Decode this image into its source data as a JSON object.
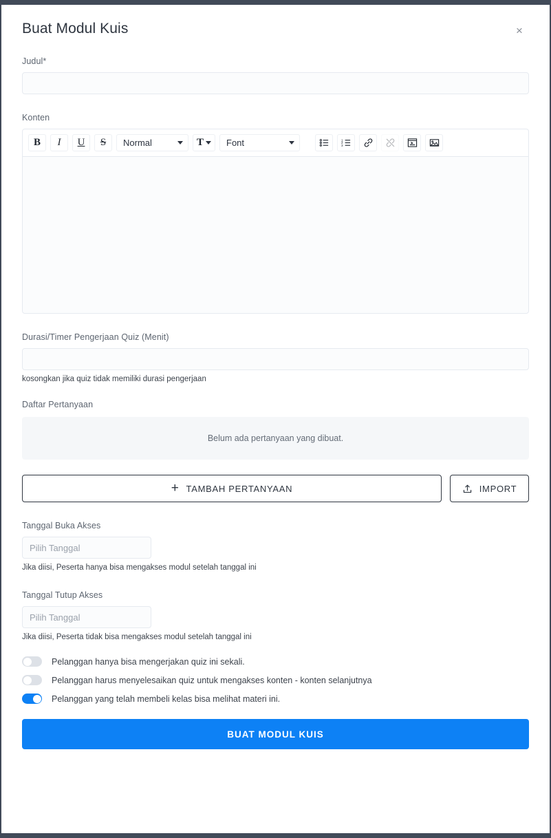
{
  "window": {
    "chrome_color": "#414a58",
    "accent_color": "#0d81f5"
  },
  "header": {
    "title": "Buat Modul Kuis",
    "close_label": "×"
  },
  "fields": {
    "judul": {
      "label": "Judul*",
      "value": "",
      "placeholder": ""
    },
    "konten": {
      "label": "Konten",
      "value": ""
    },
    "durasi": {
      "label": "Durasi/Timer Pengerjaan Quiz (Menit)",
      "value": "",
      "placeholder": "",
      "hint": "kosongkan jika quiz tidak memiliki durasi pengerjaan"
    },
    "tanggal_buka": {
      "label": "Tanggal Buka Akses",
      "value": "",
      "placeholder": "Pilih Tanggal",
      "hint": "Jika diisi, Peserta hanya bisa mengakses modul setelah tanggal ini"
    },
    "tanggal_tutup": {
      "label": "Tanggal Tutup Akses",
      "value": "",
      "placeholder": "Pilih Tanggal",
      "hint": "Jika diisi, Peserta tidak bisa mengakses modul setelah tanggal ini"
    }
  },
  "editor_toolbar": {
    "bold": "B",
    "italic": "I",
    "underline": "U",
    "strike": "S",
    "heading_select": "Normal",
    "font_select": "Font",
    "color_glyph": "T",
    "icons": [
      "bullet-list-icon",
      "ordered-list-icon",
      "link-icon",
      "unlink-icon",
      "video-icon",
      "image-icon"
    ]
  },
  "questions": {
    "label": "Daftar Pertanyaan",
    "empty_text": "Belum ada pertanyaan yang dibuat.",
    "items": [],
    "add_button": "TAMBAH PERTANYAAN",
    "import_button": "IMPORT"
  },
  "toggles": [
    {
      "label": "Pelanggan hanya bisa mengerjakan quiz ini sekali.",
      "on": false
    },
    {
      "label": "Pelanggan harus menyelesaikan quiz untuk mengakses konten - konten selanjutnya",
      "on": false
    },
    {
      "label": "Pelanggan yang telah membeli kelas bisa melihat materi ini.",
      "on": true
    }
  ],
  "submit": {
    "label": "BUAT MODUL KUIS"
  }
}
